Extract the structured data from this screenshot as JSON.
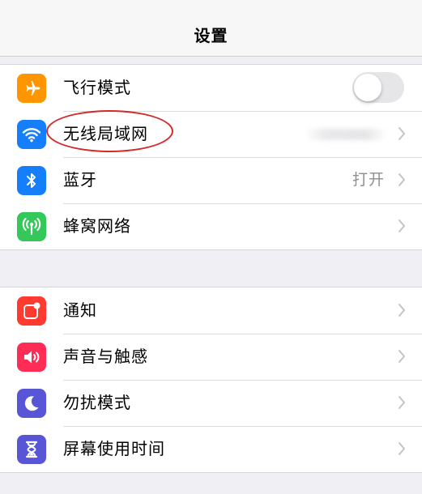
{
  "navbar": {
    "title": "设置"
  },
  "group1": [
    {
      "label": "飞行模式",
      "icon": "airplane-icon",
      "color": "#ff9500",
      "control": "toggle",
      "toggle_on": false
    },
    {
      "label": "无线局域网",
      "icon": "wifi-icon",
      "color": "#147efb",
      "control": "chevron",
      "value": ""
    },
    {
      "label": "蓝牙",
      "icon": "bluetooth-icon",
      "color": "#147efb",
      "control": "chevron",
      "value": "打开"
    },
    {
      "label": "蜂窝网络",
      "icon": "cellular-icon",
      "color": "#34c759",
      "control": "chevron",
      "value": ""
    }
  ],
  "group2": [
    {
      "label": "通知",
      "icon": "notifications-icon",
      "color": "#ff3b30"
    },
    {
      "label": "声音与触感",
      "icon": "sound-icon",
      "color": "#ff2d55"
    },
    {
      "label": "勿扰模式",
      "icon": "moon-icon",
      "color": "#5856d6"
    },
    {
      "label": "屏幕使用时间",
      "icon": "hourglass-icon",
      "color": "#5856d6"
    }
  ],
  "annotation": {
    "color": "#d42a2a"
  }
}
